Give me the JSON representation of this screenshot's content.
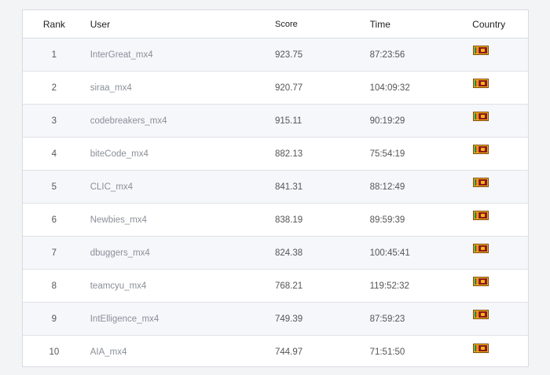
{
  "table": {
    "headers": {
      "rank": "Rank",
      "user": "User",
      "score": "Score",
      "time": "Time",
      "country": "Country"
    },
    "rows": [
      {
        "rank": "1",
        "user": "InterGreat_mx4",
        "score": "923.75",
        "time": "87:23:56",
        "flag": "sri-lanka-flag-icon"
      },
      {
        "rank": "2",
        "user": "siraa_mx4",
        "score": "920.77",
        "time": "104:09:32",
        "flag": "sri-lanka-flag-icon"
      },
      {
        "rank": "3",
        "user": "codebreakers_mx4",
        "score": "915.11",
        "time": "90:19:29",
        "flag": "sri-lanka-flag-icon"
      },
      {
        "rank": "4",
        "user": "biteCode_mx4",
        "score": "882.13",
        "time": "75:54:19",
        "flag": "sri-lanka-flag-icon"
      },
      {
        "rank": "5",
        "user": "CLIC_mx4",
        "score": "841.31",
        "time": "88:12:49",
        "flag": "sri-lanka-flag-icon"
      },
      {
        "rank": "6",
        "user": "Newbies_mx4",
        "score": "838.19",
        "time": "89:59:39",
        "flag": "sri-lanka-flag-icon"
      },
      {
        "rank": "7",
        "user": "dbuggers_mx4",
        "score": "824.38",
        "time": "100:45:41",
        "flag": "sri-lanka-flag-icon"
      },
      {
        "rank": "8",
        "user": "teamcyu_mx4",
        "score": "768.21",
        "time": "119:52:32",
        "flag": "sri-lanka-flag-icon"
      },
      {
        "rank": "9",
        "user": "IntElligence_mx4",
        "score": "749.39",
        "time": "87:59:23",
        "flag": "sri-lanka-flag-icon"
      },
      {
        "rank": "10",
        "user": "AIA_mx4",
        "score": "744.97",
        "time": "71:51:50",
        "flag": "sri-lanka-flag-icon"
      }
    ]
  },
  "colors": {
    "border": "#d9dbe0",
    "stripe": "#f6f7fb",
    "user_text": "#8a8f98"
  }
}
